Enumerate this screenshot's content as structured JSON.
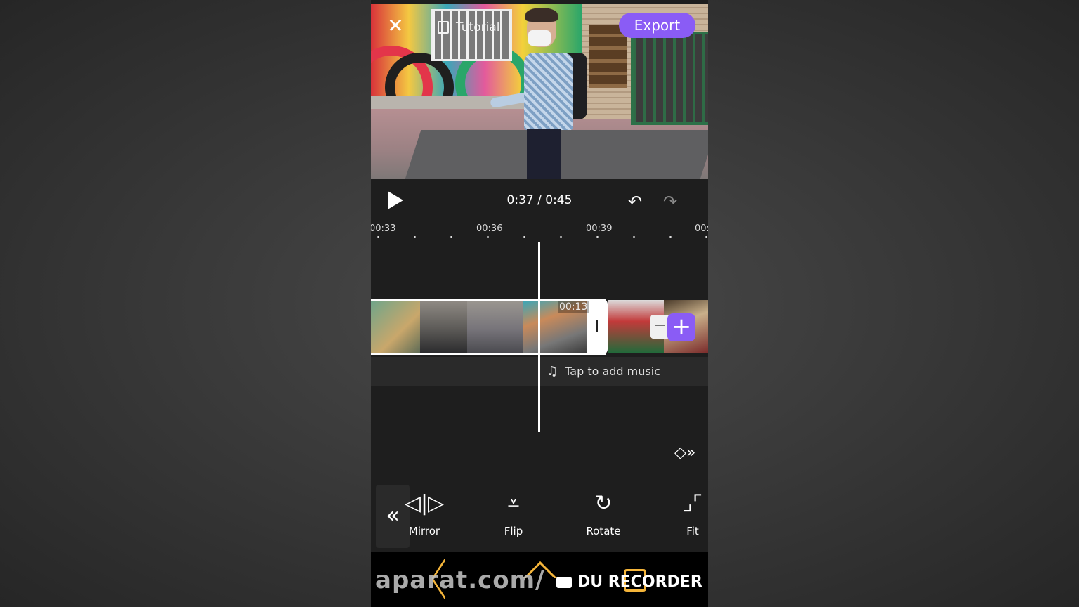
{
  "header": {
    "tutorial_label": "Tutorial",
    "export_label": "Export"
  },
  "playback": {
    "current_time": "0:37",
    "separator": "/",
    "total_time": "0:45"
  },
  "ruler": {
    "labels": [
      "00:33",
      "00:36",
      "00:39",
      "00:"
    ]
  },
  "timeline": {
    "clip_duration": "00:13",
    "music_placeholder": "Tap to add music"
  },
  "toolbar": {
    "tools": [
      {
        "label": "Mirror",
        "icon": "mirror-icon"
      },
      {
        "label": "Flip",
        "icon": "flip-icon"
      },
      {
        "label": "Rotate",
        "icon": "rotate-icon"
      },
      {
        "label": "Fit",
        "icon": "fit-icon"
      }
    ]
  },
  "overlay": {
    "watermark": "aparat.com/",
    "recorder_label": "DU RECORDER"
  },
  "colors": {
    "accent": "#8a5cf5",
    "nav_icons": "#f5b53a"
  }
}
